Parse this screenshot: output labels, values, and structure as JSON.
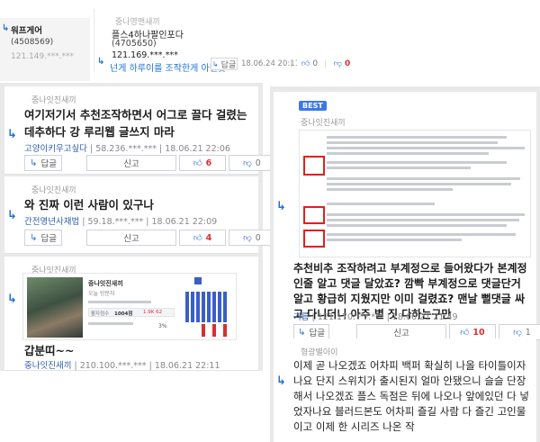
{
  "top": {
    "left_user": "워프게어",
    "left_id": "(4508569)",
    "left_ip": "121.149.***.***",
    "center_user": "중나영맨새끼",
    "center_nick": "플스4하나팔인포다",
    "center_id": "(4705650)",
    "center_ip": "121.169.***.***",
    "center_title": "넌게 하루이를 조작한게 아닌듯",
    "reply": "답글",
    "datetime": "18.06.24 20:11",
    "up": "0",
    "down": "0"
  },
  "left_cards": [
    {
      "user": "중나잇진새끼",
      "title": "여기저기서 추천조작하면서 어그로 끌다 걸렸는데추하다 강 루리웹 글쓰지 마라",
      "author": "고양이키우고싶다",
      "ip": "58.236.***.***",
      "datetime": "18.06.21 22:06",
      "reply": "답글",
      "report": "신고",
      "up": "6",
      "down": "0"
    },
    {
      "user": "중나잇진새끼",
      "title": "와 진짜 이런 사람이 있구나",
      "author": "간전영년사재법",
      "ip": "59.18.***.***",
      "datetime": "18.06.21 22:09",
      "reply": "답글",
      "report": "신고",
      "up": "4",
      "down": "0"
    },
    {
      "user": "중나잇진새끼",
      "title": "갑분띠~~",
      "author": "중나잇진새끼",
      "ip": "210.100.***.***",
      "datetime": "18.06.21 22:11"
    }
  ],
  "embed": {
    "name": "중나잇진새끼",
    "sub": "오늘 방문자",
    "label": "활자점수",
    "value": "1004점",
    "trend": "1.9K 62",
    "pct": "3%"
  },
  "right_cards": [
    {
      "badge": "BEST",
      "user": "중나잇진새끼",
      "title": "추천비추 조작하려고 부계정으로 들어왔다가 본계정인줄 알고 댓글 달았죠? 깜빡 부계정으로 댓글단거 알고 황급히 지웠지만 이미 걸렸죠? 맨날 뻘댓글 싸고 다니더니 아주 별 짓 다하는구만",
      "author": "기름",
      "ip": "121.170.***.***",
      "datetime": "18.06.21 21:49",
      "reply": "답글",
      "report": "신고",
      "up": "10",
      "down": "1"
    },
    {
      "user": "형광별아이",
      "title": "이제 곧 나오겠죠 어차피 백퍼 확실히 나올 타이틀이자나요 단지 스위치가 출시된지 얼마 안됐으니 슬슬 단장해서 나오겠죠 플스 독점은 뒤에 나오나 앞에있던 다 넣었자나요 블러드본도 어차피 즐길 사람 다 즐긴 고인물이고 이제 한 시리즈 나온 작"
    }
  ]
}
